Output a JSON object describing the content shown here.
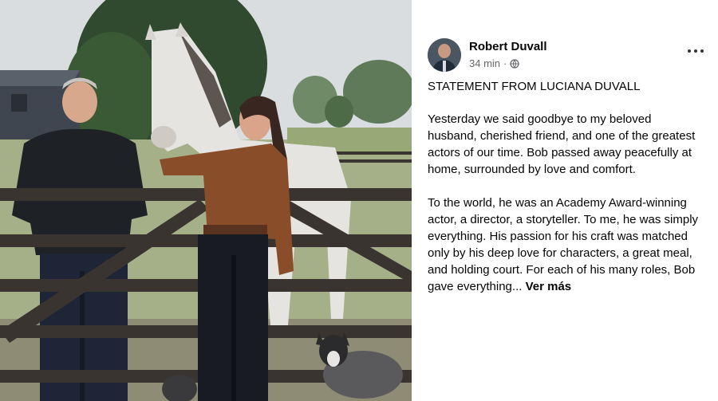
{
  "post": {
    "author": "Robert Duvall",
    "time": "34 min",
    "dot": "·",
    "heading": "STATEMENT FROM LUCIANA DUVALL",
    "paragraph1": "Yesterday we said goodbye to my beloved husband, cherished friend, and one of the greatest actors of our time. Bob passed away peacefully at home, surrounded by love and comfort.",
    "paragraph2": "To the world, he was an Academy Award-winning actor, a director, a storyteller. To me, he was simply everything. His passion for his craft was matched only by his deep love for characters, a great meal, and holding court. For each of his many roles, Bob gave everything...",
    "see_more": "Ver más"
  },
  "icons": {
    "audience": "globe-icon",
    "menu": "more-options-icon"
  },
  "colors": {
    "secondary_text": "#65676b",
    "primary_text": "#050505"
  }
}
